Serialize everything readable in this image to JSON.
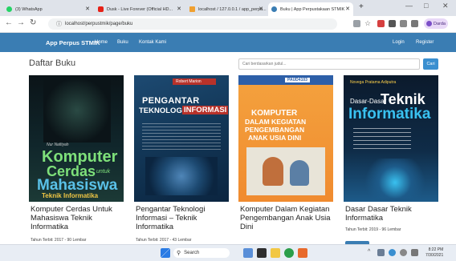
{
  "browser": {
    "tabs": [
      {
        "label": "(3) WhatsApp",
        "favicon_color": "#25d366"
      },
      {
        "label": "Dusk - Live Forever (Official HD...",
        "favicon_color": "#e62117"
      },
      {
        "label": "localhost / 127.0.0.1 / app_perpu...",
        "favicon_color": "#f0a030"
      },
      {
        "label": "Buku | App Perpustakaan STMIK",
        "favicon_color": "#3a7db3"
      }
    ],
    "new_tab": "+",
    "window_controls": [
      "—",
      "□",
      "✕"
    ],
    "url": "localhost/perpustmik/page/buku",
    "profile_label": "Darda"
  },
  "navbar": {
    "brand": "App Perpus STMIK",
    "links": [
      "Home",
      "Buku",
      "Kontak Kami"
    ],
    "login": "Login",
    "register": "Register",
    "color": "#3a7db3"
  },
  "main": {
    "title": "Daftar Buku",
    "search_placeholder": "Cari berdasarkan judul...",
    "search_button": "Cari"
  },
  "books": [
    {
      "title": "Komputer Cerdas Untuk Mahasiswa Teknik Informatika",
      "meta": "Tahun Terbit: 2017 - 90 Lembar",
      "cover_author": "Nur Nafiiyah",
      "cover_line1": "Komputer",
      "cover_line2": "Cerdas",
      "cover_line2b": "untuk",
      "cover_line3": "Mahasiswa",
      "cover_line4": "Teknik Informatika"
    },
    {
      "title": "Pengantar Teknologi Informasi – Teknik Informatika",
      "meta": "Tahun Terbit: 2017 - 43 Lembar",
      "cover_author": "Robert Marion",
      "cover_line1": "PENGANTAR",
      "cover_line2": "TEKNOLOGI",
      "cover_line2b": "INFORMASI"
    },
    {
      "title": "Komputer Dalam Kegiatan Pengembangan Anak Usia Dini",
      "meta": "",
      "cover_tag": "PAUD4103",
      "cover_line1": "KOMPUTER",
      "cover_line2": "DALAM KEGIATAN",
      "cover_line3": "PENGEMBANGAN",
      "cover_line4": "ANAK USIA DINI"
    },
    {
      "title": "Dasar Dasar Teknik Informatika",
      "meta": "Tahun Terbit: 2019 - 96 Lembar",
      "cover_author": "Novega Pratama Adiputra",
      "cover_line1": "Dasar-Dasar",
      "cover_line2": "Teknik",
      "cover_line3": "Informatika"
    }
  ],
  "taskbar": {
    "search_label": "Search",
    "time": "8:22 PM",
    "date": "7/30/2021"
  }
}
